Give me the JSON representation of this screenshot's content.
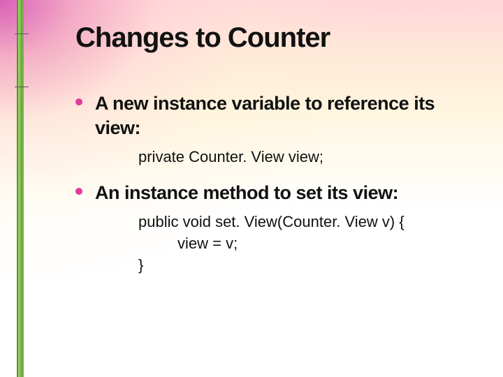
{
  "title": "Changes to Counter",
  "bullets": [
    {
      "text": "A new instance variable to reference its view:",
      "code": [
        {
          "text": "private Counter. View view;",
          "indent": 0
        }
      ]
    },
    {
      "text": "An instance method to set its view:",
      "code": [
        {
          "text": "public void set. View(Counter. View v) {",
          "indent": 0
        },
        {
          "text": "view = v;",
          "indent": 1
        },
        {
          "text": "}",
          "indent": 0
        }
      ]
    }
  ]
}
